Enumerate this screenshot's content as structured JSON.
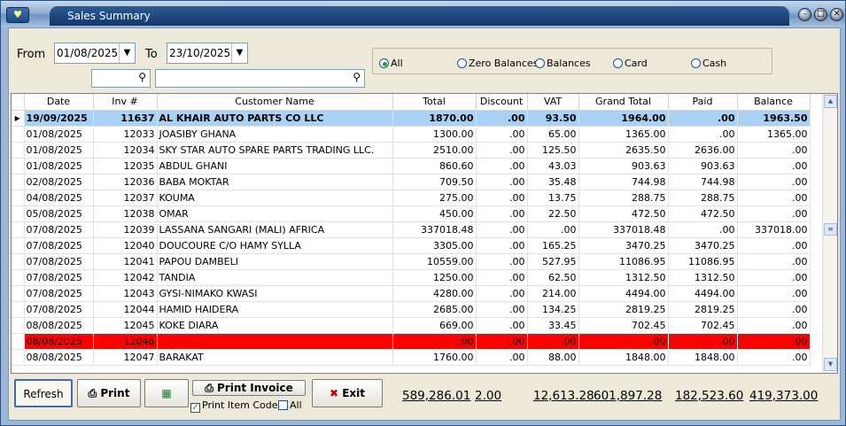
{
  "window": {
    "title": "Sales Summary"
  },
  "filters": {
    "from_label": "From",
    "from_date": "01/08/2025",
    "to_label": "To",
    "to_date": "23/10/2025"
  },
  "radios": [
    {
      "label": "All",
      "selected": true
    },
    {
      "label": "Zero Balances",
      "selected": false
    },
    {
      "label": "Balances",
      "selected": false
    },
    {
      "label": "Card",
      "selected": false
    },
    {
      "label": "Cash",
      "selected": false
    }
  ],
  "grid": {
    "columns": [
      "Date",
      "Inv #",
      "Customer Name",
      "Total",
      "Discount",
      "VAT",
      "Grand Total",
      "Paid",
      "Balance"
    ],
    "rows": [
      [
        "19/09/2025",
        "11637",
        "AL KHAIR AUTO PARTS CO LLC",
        "1870.00",
        ".00",
        "93.50",
        "1964.00",
        ".00",
        "1963.50"
      ],
      [
        "01/08/2025",
        "12033",
        "JOASIBY GHANA",
        "1300.00",
        ".00",
        "65.00",
        "1365.00",
        ".00",
        "1365.00"
      ],
      [
        "01/08/2025",
        "12034",
        "SKY STAR AUTO SPARE PARTS TRADING LLC.",
        "2510.00",
        ".00",
        "125.50",
        "2635.50",
        "2636.00",
        ".00"
      ],
      [
        "01/08/2025",
        "12035",
        "ABDUL GHANI",
        "860.60",
        ".00",
        "43.03",
        "903.63",
        "903.63",
        ".00"
      ],
      [
        "02/08/2025",
        "12036",
        "BABA MOKTAR",
        "709.50",
        ".00",
        "35.48",
        "744.98",
        "744.98",
        ".00"
      ],
      [
        "04/08/2025",
        "12037",
        "KOUMA",
        "275.00",
        ".00",
        "13.75",
        "288.75",
        "288.75",
        ".00"
      ],
      [
        "05/08/2025",
        "12038",
        "OMAR",
        "450.00",
        ".00",
        "22.50",
        "472.50",
        "472.50",
        ".00"
      ],
      [
        "07/08/2025",
        "12039",
        "LASSANA SANGARI (MALI) AFRICA",
        "337018.48",
        ".00",
        ".00",
        "337018.48",
        ".00",
        "337018.00"
      ],
      [
        "07/08/2025",
        "12040",
        "DOUCOURE C/O HAMY SYLLA",
        "3305.00",
        ".00",
        "165.25",
        "3470.25",
        "3470.25",
        ".00"
      ],
      [
        "07/08/2025",
        "12041",
        "PAPOU DAMBELI",
        "10559.00",
        ".00",
        "527.95",
        "11086.95",
        "11086.95",
        ".00"
      ],
      [
        "07/08/2025",
        "12042",
        "TANDIA",
        "1250.00",
        ".00",
        "62.50",
        "1312.50",
        "1312.50",
        ".00"
      ],
      [
        "07/08/2025",
        "12043",
        "GYSI-NIMAKO KWASI",
        "4280.00",
        ".00",
        "214.00",
        "4494.00",
        "4494.00",
        ".00"
      ],
      [
        "07/08/2025",
        "12044",
        "HAMID HAIDERA",
        "2685.00",
        ".00",
        "134.25",
        "2819.25",
        "2819.25",
        ".00"
      ],
      [
        "08/08/2025",
        "12045",
        "KOKE DIARA",
        "669.00",
        ".00",
        "33.45",
        "702.45",
        "702.45",
        ".00"
      ],
      [
        "08/08/2025",
        "12046",
        "",
        ".00",
        ".00",
        ".00",
        ".00",
        ".00",
        ".00"
      ],
      [
        "08/08/2025",
        "12047",
        "BARAKAT",
        "1760.00",
        ".00",
        "88.00",
        "1848.00",
        "1848.00",
        ".00"
      ]
    ],
    "selected_row": 0,
    "highlight_row": 14,
    "highlight_color": "#ff0000",
    "selection_color": "#a8d2f5"
  },
  "buttons": {
    "refresh": "Refresh",
    "print": "Print",
    "excel_icon": "excel-icon",
    "print_invoice": "Print Invoice",
    "exit": "Exit"
  },
  "checkboxes": {
    "print_item_code": {
      "label": "Print Item Code",
      "checked": true
    },
    "all": {
      "label": "All",
      "checked": false
    }
  },
  "totals": {
    "total": "589,286.01",
    "discount": "2.00",
    "vat": "12,613.28",
    "grand_total": "601,897.28",
    "paid": "182,523.60",
    "balance": "419,373.00"
  }
}
